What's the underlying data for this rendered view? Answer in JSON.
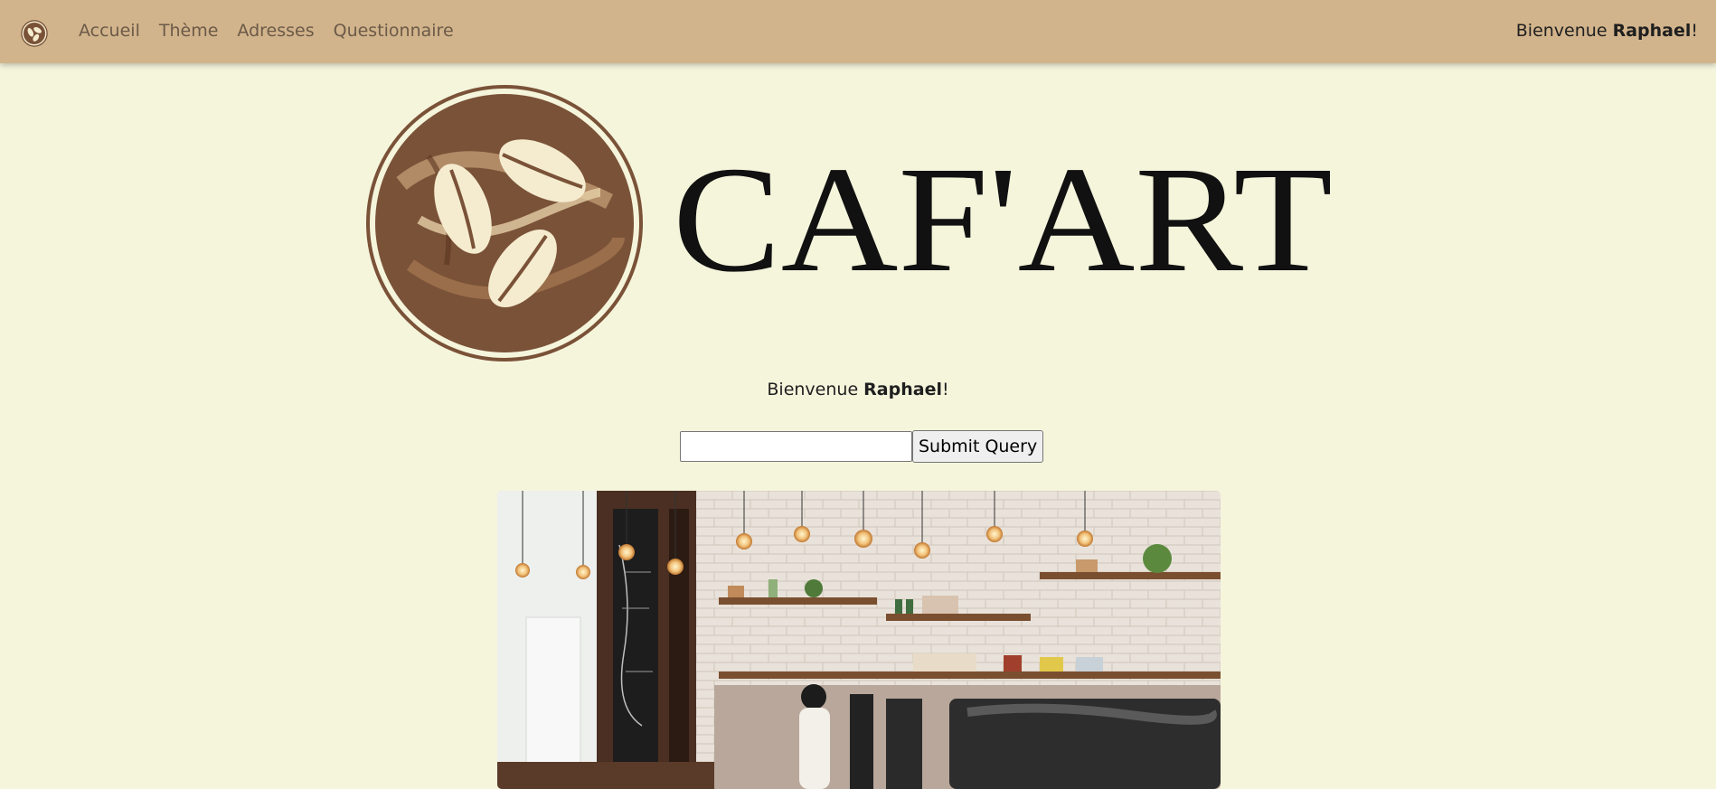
{
  "nav": {
    "logo_icon": "coffee-beans-logo-icon",
    "links": [
      {
        "label": "Accueil"
      },
      {
        "label": "Thème"
      },
      {
        "label": "Adresses"
      },
      {
        "label": "Questionnaire"
      }
    ],
    "welcome_prefix": "Bienvenue ",
    "welcome_user": "Raphael",
    "welcome_suffix": "!"
  },
  "hero": {
    "brand_text": "CAF'ART",
    "logo_icon": "coffee-beans-logo-icon"
  },
  "welcome": {
    "prefix": "Bienvenue ",
    "user": "Raphael",
    "suffix": "!"
  },
  "search": {
    "value": "",
    "placeholder": "",
    "submit_label": "Submit Query"
  },
  "photo": {
    "subject": "cafe-interior-photo"
  },
  "colors": {
    "navbar": "#d2b48c",
    "background": "#f5f5dc",
    "logo_brown": "#7a5238",
    "logo_cream": "#f5eccf"
  }
}
